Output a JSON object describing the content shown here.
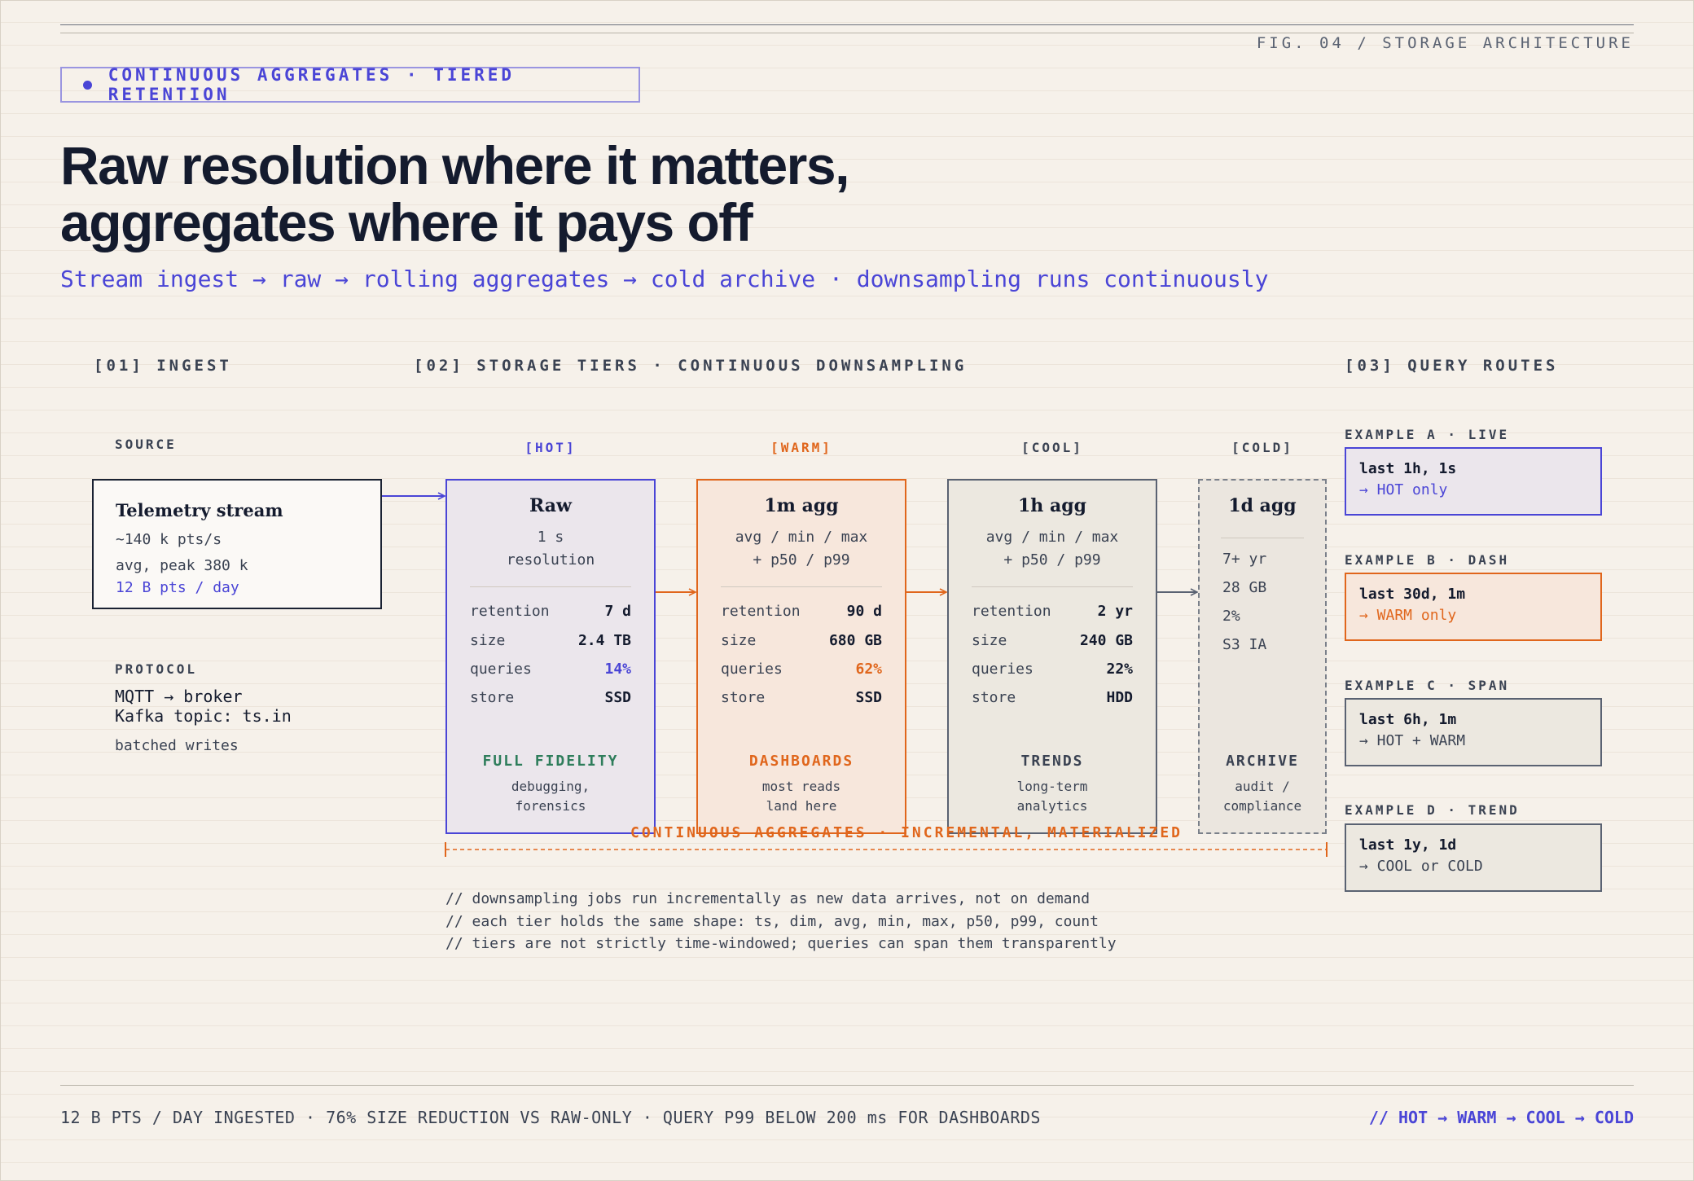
{
  "figure_label": "FIG. 04 / STORAGE ARCHITECTURE",
  "tag": "CONTINUOUS AGGREGATES · TIERED RETENTION",
  "headline": {
    "line1": "Raw resolution where it matters,",
    "line2": "aggregates where it pays off"
  },
  "subtitle": "Stream ingest → raw → rolling aggregates → cold archive · downsampling runs continuously",
  "sections": {
    "ingest": "[01] INGEST",
    "storage": "[02] STORAGE TIERS · CONTINUOUS DOWNSAMPLING",
    "query": "[03] QUERY ROUTES"
  },
  "source": {
    "label": "SOURCE",
    "title": "Telemetry stream",
    "rate": "~140 k pts/s",
    "peak": "avg, peak 380 k",
    "daily": "12 B pts / day"
  },
  "protocol": {
    "label": "PROTOCOL",
    "line1": "MQTT → broker",
    "line2": "Kafka topic: ts.in",
    "line3": "batched writes"
  },
  "tiers": [
    {
      "tag": "[HOT]",
      "title": "Raw",
      "desc1": "1 s",
      "desc2": "resolution",
      "rows": [
        {
          "k": "retention",
          "v": "7 d"
        },
        {
          "k": "size",
          "v": "2.4 TB"
        },
        {
          "k": "queries",
          "v": "14%"
        },
        {
          "k": "store",
          "v": "SSD"
        }
      ],
      "role": "FULL FIDELITY",
      "role_desc1": "debugging,",
      "role_desc2": "forensics"
    },
    {
      "tag": "[WARM]",
      "title": "1m agg",
      "desc1": "avg / min / max",
      "desc2": "+ p50 / p99",
      "rows": [
        {
          "k": "retention",
          "v": "90 d"
        },
        {
          "k": "size",
          "v": "680 GB"
        },
        {
          "k": "queries",
          "v": "62%"
        },
        {
          "k": "store",
          "v": "SSD"
        }
      ],
      "role": "DASHBOARDS",
      "role_desc1": "most reads",
      "role_desc2": "land here"
    },
    {
      "tag": "[COOL]",
      "title": "1h agg",
      "desc1": "avg / min / max",
      "desc2": "+ p50 / p99",
      "rows": [
        {
          "k": "retention",
          "v": "2 yr"
        },
        {
          "k": "size",
          "v": "240 GB"
        },
        {
          "k": "queries",
          "v": "22%"
        },
        {
          "k": "store",
          "v": "HDD"
        }
      ],
      "role": "TRENDS",
      "role_desc1": "long-term",
      "role_desc2": "analytics"
    },
    {
      "tag": "[COLD]",
      "title": "1d agg",
      "lines": [
        "7+ yr",
        "28 GB",
        "2%",
        "S3 IA"
      ],
      "role": "ARCHIVE",
      "role_desc1": "audit /",
      "role_desc2": "compliance"
    }
  ],
  "routes": [
    {
      "label": "EXAMPLE A · LIVE",
      "query": "last 1h, 1s",
      "target": "→ HOT only"
    },
    {
      "label": "EXAMPLE B · DASH",
      "query": "last 30d, 1m",
      "target": "→ WARM only"
    },
    {
      "label": "EXAMPLE C · SPAN",
      "query": "last 6h, 1m",
      "target": "→ HOT + WARM"
    },
    {
      "label": "EXAMPLE D · TREND",
      "query": "last 1y, 1d",
      "target": "→ COOL or COLD"
    }
  ],
  "continuous_label": "CONTINUOUS AGGREGATES · INCREMENTAL, MATERIALIZED",
  "comments": [
    "// downsampling jobs run incrementally as new data arrives, not on demand",
    "// each tier holds the same shape: ts, dim, avg, min, max, p50, p99, count",
    "// tiers are not strictly time-windowed; queries can span them transparently"
  ],
  "footer": {
    "left": "12 B PTS / DAY INGESTED · 76% SIZE REDUCTION VS RAW-ONLY · QUERY P99 BELOW 200 ms FOR DASHBOARDS",
    "right": "// HOT → WARM → COOL → COLD"
  },
  "colors": {
    "accent": "#4a45d6",
    "warm": "#e0661c",
    "fidelity": "#2e7d5b",
    "ink": "#141b2e",
    "background": "#f6f1ea"
  }
}
